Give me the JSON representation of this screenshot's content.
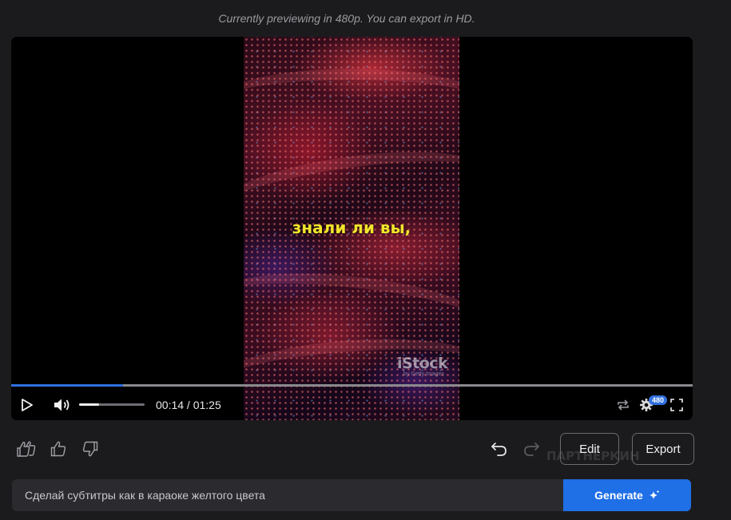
{
  "header": {
    "notice": "Currently previewing in 480p. You can export in HD."
  },
  "player": {
    "subtitle": "знали ли вы,",
    "watermark": "iStock",
    "watermark_sub": "by Getty Images",
    "current_time": "00:14",
    "duration": "01:25",
    "time_separator": " / ",
    "progress_fraction": 0.164,
    "volume_fraction": 0.3,
    "resolution_badge": "480",
    "accent_color": "#2f6fe0"
  },
  "actions": {
    "edit_label": "Edit",
    "export_label": "Export"
  },
  "background_watermark": "ПАРТНЕРКИН",
  "prompt": {
    "value": "Сделай субтитры как в караоке желтого цвета",
    "generate_label": "Generate"
  },
  "icons": {
    "play": "play-icon",
    "volume": "volume-icon",
    "loop": "loop-icon",
    "settings": "gear-icon",
    "fullscreen": "fullscreen-icon",
    "super_like": "double-thumbs-up-icon",
    "like": "thumbs-up-icon",
    "dislike": "thumbs-down-icon",
    "undo": "undo-icon",
    "redo": "redo-icon",
    "sparkle": "sparkle-icon"
  }
}
